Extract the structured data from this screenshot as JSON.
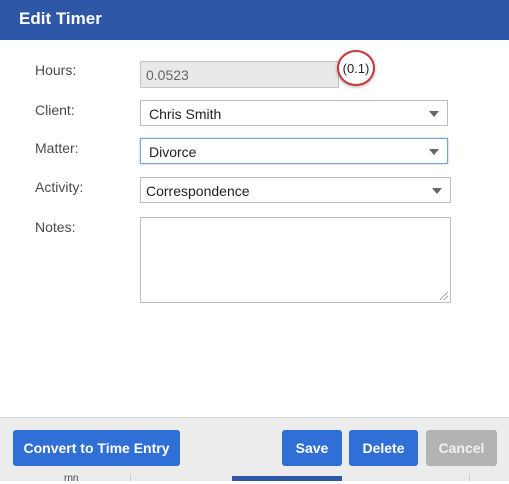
{
  "dialog": {
    "title": "Edit Timer"
  },
  "form": {
    "hours_label": "Hours:",
    "hours_value": "0.0523",
    "rounded_hours": "(0.1)",
    "client_label": "Client:",
    "client_value": "Chris Smith",
    "matter_label": "Matter:",
    "matter_value": "Divorce",
    "activity_label": "Activity:",
    "activity_value": "Correspondence",
    "notes_label": "Notes:",
    "notes_value": ""
  },
  "footer": {
    "convert_label": "Convert to Time Entry",
    "save_label": "Save",
    "delete_label": "Delete",
    "cancel_label": "Cancel"
  },
  "background": {
    "partial_text": "rnn"
  },
  "colors": {
    "title_bar": "#2e57a8",
    "primary_button": "#2f6fd6",
    "disabled_button": "#b3b3b3",
    "highlight_circle": "#c9363b"
  }
}
